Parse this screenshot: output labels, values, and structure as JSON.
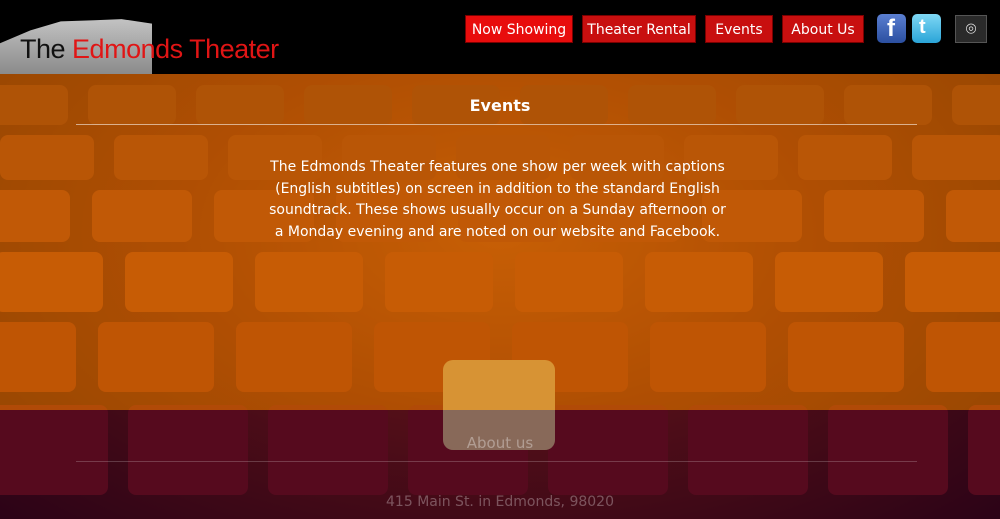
{
  "logo": {
    "the": "The",
    "name": "Edmonds Theater"
  },
  "nav": {
    "items": [
      {
        "label": "Now Showing",
        "active": true
      },
      {
        "label": "Theater Rental",
        "active": false
      },
      {
        "label": "Events",
        "active": false
      },
      {
        "label": "About Us",
        "active": false
      }
    ]
  },
  "social": {
    "facebook_icon": "facebook-icon",
    "facebook_glyph": "f",
    "twitter_icon": "twitter-icon",
    "twitter_glyph": "t",
    "instagram_icon": "instagram-icon",
    "instagram_glyph": "◎"
  },
  "events": {
    "title": "Events",
    "body": "The Edmonds Theater features one show per week with captions (English subtitles) on screen in addition to the standard English soundtrack. These shows usually occur on a Sunday afternoon or a Monday evening and are noted on our website and Facebook."
  },
  "about": {
    "title": "About us",
    "address": "415 Main St. in Edmonds, 98020"
  },
  "colors": {
    "nav_red": "#c80f0f",
    "header_bg": "#000000",
    "events_band": "#c66c00",
    "logo_red": "#e01515"
  }
}
